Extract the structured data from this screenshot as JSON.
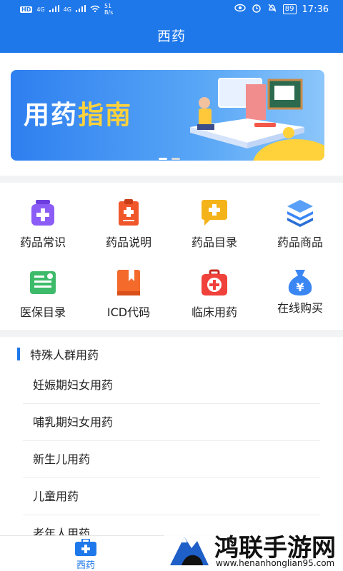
{
  "status": {
    "net_speed": "51",
    "net_unit": "B/s",
    "battery": "89",
    "time": "17:36",
    "hd_label": "HD",
    "signal_a": "4G",
    "signal_b": "4G"
  },
  "header": {
    "title": "西药"
  },
  "banner": {
    "title_a": "用药",
    "title_b": "指南"
  },
  "grid": {
    "items": [
      {
        "label": "药品常识",
        "icon": "medicine-bottle-icon",
        "color": "#8b5cf6"
      },
      {
        "label": "药品说明",
        "icon": "clipboard-plus-icon",
        "color": "#f0572b"
      },
      {
        "label": "药品目录",
        "icon": "chat-plus-icon",
        "color": "#f5b31a"
      },
      {
        "label": "药品商品",
        "icon": "layers-icon",
        "color": "#3a86f3"
      },
      {
        "label": "医保目录",
        "icon": "insurance-card-icon",
        "color": "#3dbb6a"
      },
      {
        "label": "ICD代码",
        "icon": "book-bookmark-icon",
        "color": "#f36a2b"
      },
      {
        "label": "临床用药",
        "icon": "first-aid-kit-icon",
        "color": "#f0413a"
      },
      {
        "label": "在线购买",
        "icon": "yen-money-bag-icon",
        "color": "#3a86f3"
      }
    ]
  },
  "section": {
    "title": "特殊人群用药",
    "items": [
      "妊娠期妇女用药",
      "哺乳期妇女用药",
      "新生儿用药",
      "儿童用药",
      "老年人用药"
    ]
  },
  "bottom_nav": {
    "tab_label": "西药"
  },
  "watermark": {
    "name": "鸿联手游网",
    "url": "www.henanhonglian95.com"
  }
}
